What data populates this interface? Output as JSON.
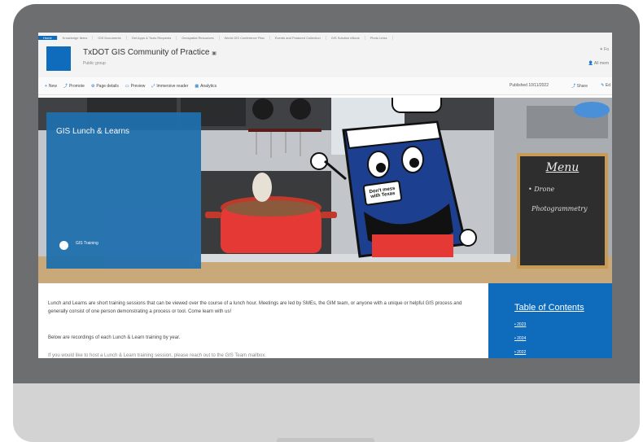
{
  "nav_items": [
    "Home",
    "Knowledge Items",
    "GIS Documents",
    "Get Apps & Tools Requests",
    "Geospatial Resources",
    "World GIS Conference Plan",
    "Events and Featured Collection",
    "GIS Solution eBook",
    "Photo Links"
  ],
  "site": {
    "title": "TxDOT GIS Community of Practice",
    "subtitle": "Public group"
  },
  "header_right": {
    "top": "✶ Fo",
    "bottom": "👤 All mem"
  },
  "command_bar": {
    "items": [
      {
        "icon": "+",
        "label": "New"
      },
      {
        "icon": "⤴",
        "label": "Promote"
      },
      {
        "icon": "⚙",
        "label": "Page details"
      },
      {
        "icon": "▭",
        "label": "Preview"
      },
      {
        "icon": "⤢",
        "label": "Immersive reader"
      },
      {
        "icon": "▦",
        "label": "Analytics"
      }
    ],
    "published": "Published 10/11/2022",
    "share": "Share",
    "edit": "Ed"
  },
  "hero": {
    "title": "GIS Lunch & Learns",
    "link": "GIS Training",
    "menu_board": {
      "title": "Menu",
      "items": [
        "• Drone",
        "Photogrammetry"
      ]
    },
    "badge": "Don't mess with Texas"
  },
  "content": {
    "paragraph1": "Lunch and Learns are short training sessions that can be viewed over the course of a lunch hour. Meetings are led by SMEs, the GIM team, or anyone with a unique or helpful GIS process and generally consist of one person demonstrating a process or tool. Come learn with us!",
    "paragraph2": "Below are recordings of each Lunch & Learn training by year.",
    "paragraph3": "If you would like to host a Lunch & Learn training session, please reach out to the GIS Team mailbox."
  },
  "toc": {
    "title": "Table of Contents",
    "items": [
      "2023",
      "2024",
      "2022"
    ]
  },
  "colors": {
    "accent": "#0f6cbd",
    "hero_panel": "#1f6fae",
    "monitor_bezel": "#6d6e70",
    "monitor_chin": "#d3d3d3"
  }
}
